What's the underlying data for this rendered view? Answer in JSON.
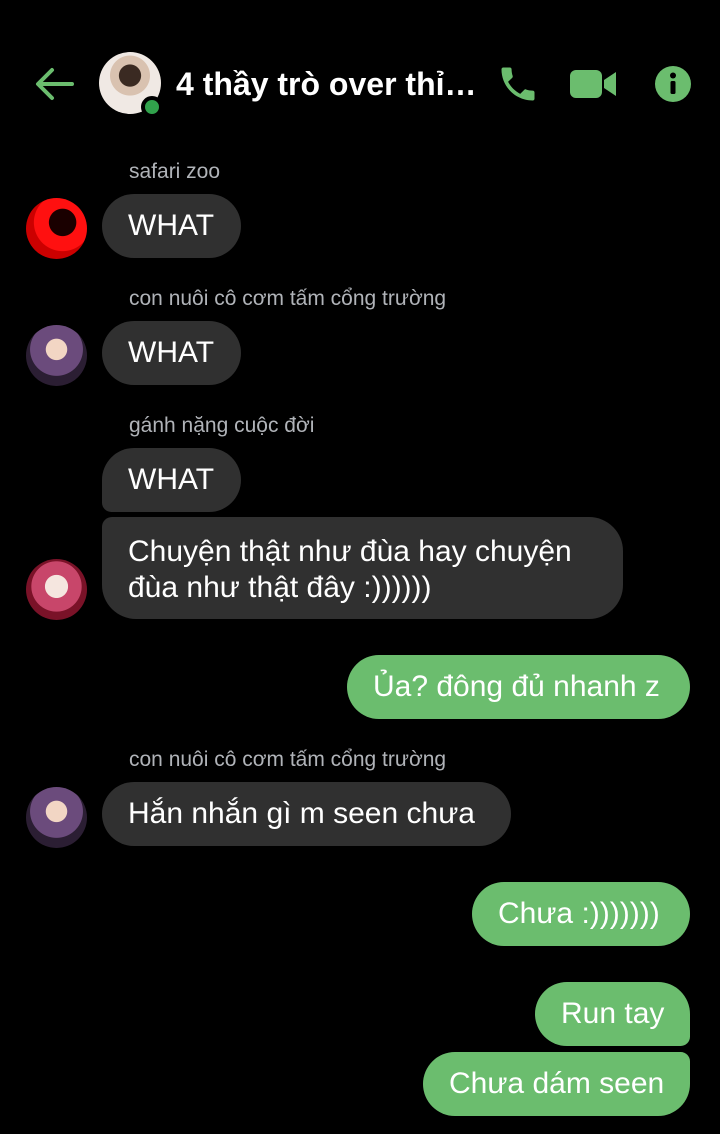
{
  "header": {
    "title": "4 thầy trò over thỉn...",
    "colors": {
      "accent": "#6bbd6e",
      "online": "#31a24c"
    }
  },
  "messages": [
    {
      "sender": "safari zoo",
      "text": "WHAT",
      "direction": "received"
    },
    {
      "sender": "con nuôi cô cơm tấm cổng trường",
      "text": "WHAT",
      "direction": "received"
    },
    {
      "sender": "gánh nặng cuộc đời",
      "text": "WHAT",
      "direction": "received"
    },
    {
      "text_line1": "Chuyện thật như đùa hay chuyện",
      "text_line2": "đùa như thật đây :))))))",
      "direction": "received"
    },
    {
      "text": "Ủa? đông đủ nhanh z",
      "direction": "sent"
    },
    {
      "sender": "con nuôi cô cơm tấm cổng trường",
      "text": "Hắn nhắn gì m seen chưa",
      "direction": "received"
    },
    {
      "text": "Chưa :)))))))",
      "direction": "sent"
    },
    {
      "text": "Run tay",
      "direction": "sent"
    },
    {
      "text": "Chưa dám seen",
      "direction": "sent"
    }
  ],
  "colors": {
    "received_bubble": "#303030",
    "sent_bubble": "#6bbd6e",
    "background": "#000000"
  }
}
